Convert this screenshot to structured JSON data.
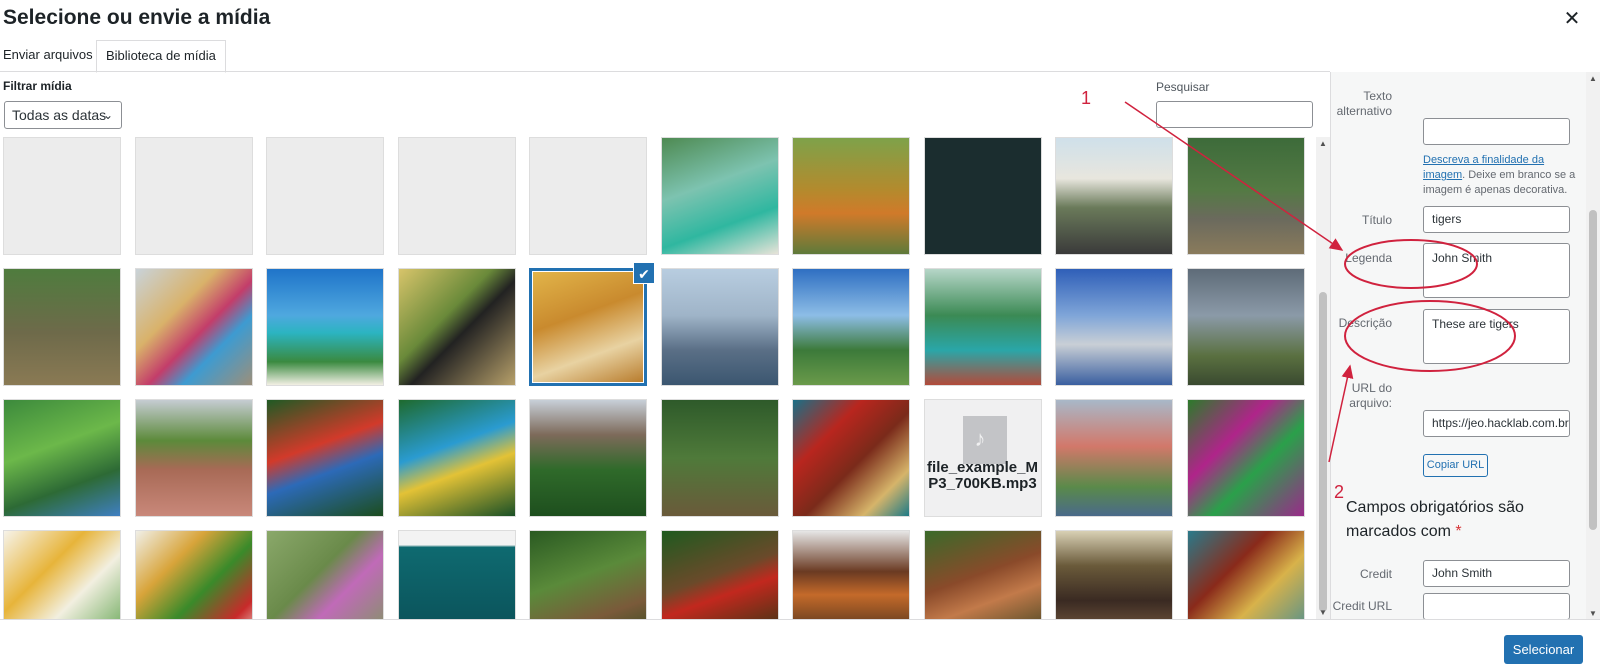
{
  "modal": {
    "title": "Selecione ou envie a mídia"
  },
  "tabs": [
    {
      "label": "Enviar arquivos"
    },
    {
      "label": "Biblioteca de mídia"
    }
  ],
  "filter": {
    "label": "Filtrar mídia",
    "date_value": "Todas as datas"
  },
  "search": {
    "label": "Pesquisar",
    "value": ""
  },
  "grid": {
    "items": [
      {
        "kind": "blank",
        "bg": "#ececec"
      },
      {
        "kind": "blank",
        "bg": "#ececec"
      },
      {
        "kind": "blank",
        "bg": "#ececec"
      },
      {
        "kind": "blank",
        "bg": "#ececec"
      },
      {
        "kind": "blank",
        "bg": "#ececec"
      },
      {
        "kind": "photo",
        "bg": "linear-gradient(160deg,#4e8a52 0%,#7dc3b0 40%,#2fb7a0 70%,#e7e3d8 100%)"
      },
      {
        "kind": "photo",
        "bg": "linear-gradient(180deg,#7ea24a 0%,#b48a2d 45%,#d07a2a 65%,#5e7a3a 100%)"
      },
      {
        "kind": "photo",
        "bg": "#1b2d2f"
      },
      {
        "kind": "photo",
        "bg": "linear-gradient(180deg,#cfe0ea 0%,#e8e6de 35%,#6a7a5a 60%,#3a3a3a 100%)"
      },
      {
        "kind": "photo",
        "bg": "linear-gradient(180deg,#3d6b3a 0%,#547a44 45%,#6b6a5d 70%,#8a7b5c 100%)"
      },
      {
        "kind": "photo",
        "bg": "linear-gradient(180deg,#4f7c3e 0%,#6e6a4a 55%,#8a7a54 100%)"
      },
      {
        "kind": "photo",
        "bg": "linear-gradient(135deg,#c9d3d9 0%,#d9b26a 35%,#c33d6a 55%,#3d9bd1 70%,#9c8f7a 100%)"
      },
      {
        "kind": "photo",
        "bg": "linear-gradient(180deg,#1f74c9 0%,#4fa8df 40%,#2bb4c1 55%,#3a8a40 80%,#f2efe4 100%)"
      },
      {
        "kind": "photo",
        "bg": "linear-gradient(135deg,#d7c46a 0%,#6a8a3a 40%,#222 55%,#b7a06a 100%)"
      },
      {
        "kind": "photo",
        "bg": "linear-gradient(160deg,#e2b54a 0%,#c98a2e 40%,#e8d2a2 70%,#b77a2a 100%)"
      },
      {
        "kind": "photo",
        "bg": "linear-gradient(180deg,#b8cde0 0%,#9fb4c8 40%,#5a6f86 70%,#3b5670 100%)"
      },
      {
        "kind": "photo",
        "bg": "linear-gradient(180deg,#2f6fc2 0%,#8dbde6 40%,#3c7a3a 70%,#6a9a4a 100%)"
      },
      {
        "kind": "photo",
        "bg": "linear-gradient(180deg,#b6d6c8 0%,#3b8a54 40%,#2aa6a8 70%,#b24a3a 100%)"
      },
      {
        "kind": "photo",
        "bg": "linear-gradient(180deg,#2f5fb8 0%,#7fa5d8 40%,#c9cfd6 65%,#3a5fa0 100%)"
      },
      {
        "kind": "photo",
        "bg": "linear-gradient(180deg,#5e6b78 0%,#8b9aa8 40%,#5a7040 75%,#3a4a30 100%)"
      },
      {
        "kind": "photo",
        "bg": "linear-gradient(160deg,#3c8a3c 0%,#6cb84a 40%,#2d6a35 70%,#3f7fc2 100%)"
      },
      {
        "kind": "photo",
        "bg": "linear-gradient(180deg,#c5ccd2 0%,#5c8a3a 35%,#a86a56 60%,#c9887a 100%)"
      },
      {
        "kind": "photo",
        "bg": "linear-gradient(160deg,#1f5a24 0%,#d23a2a 40%,#2c6ab8 60%,#1c4d1e 100%)"
      },
      {
        "kind": "photo",
        "bg": "linear-gradient(160deg,#1e6a2e 0%,#2a9bd1 40%,#e3c236 60%,#1a5026 100%)"
      },
      {
        "kind": "photo",
        "bg": "linear-gradient(180deg,#c7cfd8 0%,#7d6a5a 30%,#2f6a2a 60%,#1e4f1e 100%)"
      },
      {
        "kind": "photo",
        "bg": "linear-gradient(180deg,#2e5a2a 0%,#4f7a3a 50%,#6a5a3a 100%)"
      },
      {
        "kind": "photo",
        "bg": "linear-gradient(135deg,#1a6f86 0%,#b8261e 30%,#7a2a1a 55%,#d6b46a 80%,#1e7a86 100%)"
      },
      {
        "kind": "file",
        "name": "file_example_MP3_700KB.mp3"
      },
      {
        "kind": "photo",
        "bg": "linear-gradient(180deg,#a8b8c8 0%,#d2786a 40%,#5a8a4a 75%,#4a6a8a 100%)"
      },
      {
        "kind": "photo",
        "bg": "linear-gradient(135deg,#2c7a2a 0%,#b0248a 35%,#2aa04a 60%,#9a2a8a 100%)"
      },
      {
        "kind": "photo",
        "bg": "linear-gradient(135deg,#f6f3ea 0%,#e7b43a 35%,#f2efe0 60%,#5aa04a 100%)"
      },
      {
        "kind": "photo",
        "bg": "linear-gradient(135deg,#f0efe8 0%,#d8a43a 30%,#3a8a2a 55%,#c82a2a 80%,#f0efe8 100%)"
      },
      {
        "kind": "photo",
        "bg": "linear-gradient(135deg,#8aa86a 0%,#6a8a4a 40%,#c06ab8 60%,#7a9a5a 100%)"
      },
      {
        "kind": "photo",
        "bg": "linear-gradient(180deg,#f3f3f3 0%,#f3f3f3 12%,#0e6a70 14%,#0b4d55 100%)"
      },
      {
        "kind": "photo",
        "bg": "linear-gradient(160deg,#2a5a22 0%,#5a8a3a 40%,#7a5a3a 70%,#2a4a1a 100%)"
      },
      {
        "kind": "photo",
        "bg": "linear-gradient(160deg,#1f5a1f 0%,#6a4a2a 40%,#c2281e 55%,#1a3a12 100%)"
      },
      {
        "kind": "photo",
        "bg": "linear-gradient(180deg,#e6e6e6 0%,#6a3a22 35%,#c46a2a 55%,#2a2218 100%)"
      },
      {
        "kind": "photo",
        "bg": "linear-gradient(160deg,#3a6a2a 0%,#8a4a2a 40%,#c27a4a 60%,#2a3a1a 100%)"
      },
      {
        "kind": "photo",
        "bg": "linear-gradient(180deg,#d8d0b4 0%,#6a5a3a 30%,#3a2a22 60%,#8a6a4a 100%)"
      },
      {
        "kind": "photo",
        "bg": "linear-gradient(135deg,#2a7a8a 0%,#8a2a1a 35%,#d8b24a 60%,#3a8a9a 100%)"
      }
    ],
    "selected_index": 14
  },
  "details": {
    "alt_label": "Texto alternativo",
    "alt_value": "",
    "help_link": "Descreva a finalidade da imagem",
    "help_text": ". Deixe em branco se a imagem é apenas decorativa.",
    "title_label": "Título",
    "title_value": "tigers",
    "caption_label": "Legenda",
    "caption_value": "John Smith",
    "desc_label": "Descrição",
    "desc_value": "These are tigers",
    "url_label": "URL do arquivo:",
    "url_value": "https://jeo.hacklab.com.br",
    "copy_button": "Copiar URL",
    "required_text": "Campos obrigatórios são marcados com",
    "required_star": "*",
    "credit_label": "Credit",
    "credit_value": "John Smith",
    "credit_url_label": "Credit URL"
  },
  "footer": {
    "select_button": "Selecionar"
  },
  "annotations": {
    "num1": "1",
    "num2": "2",
    "color": "#d0223e"
  }
}
